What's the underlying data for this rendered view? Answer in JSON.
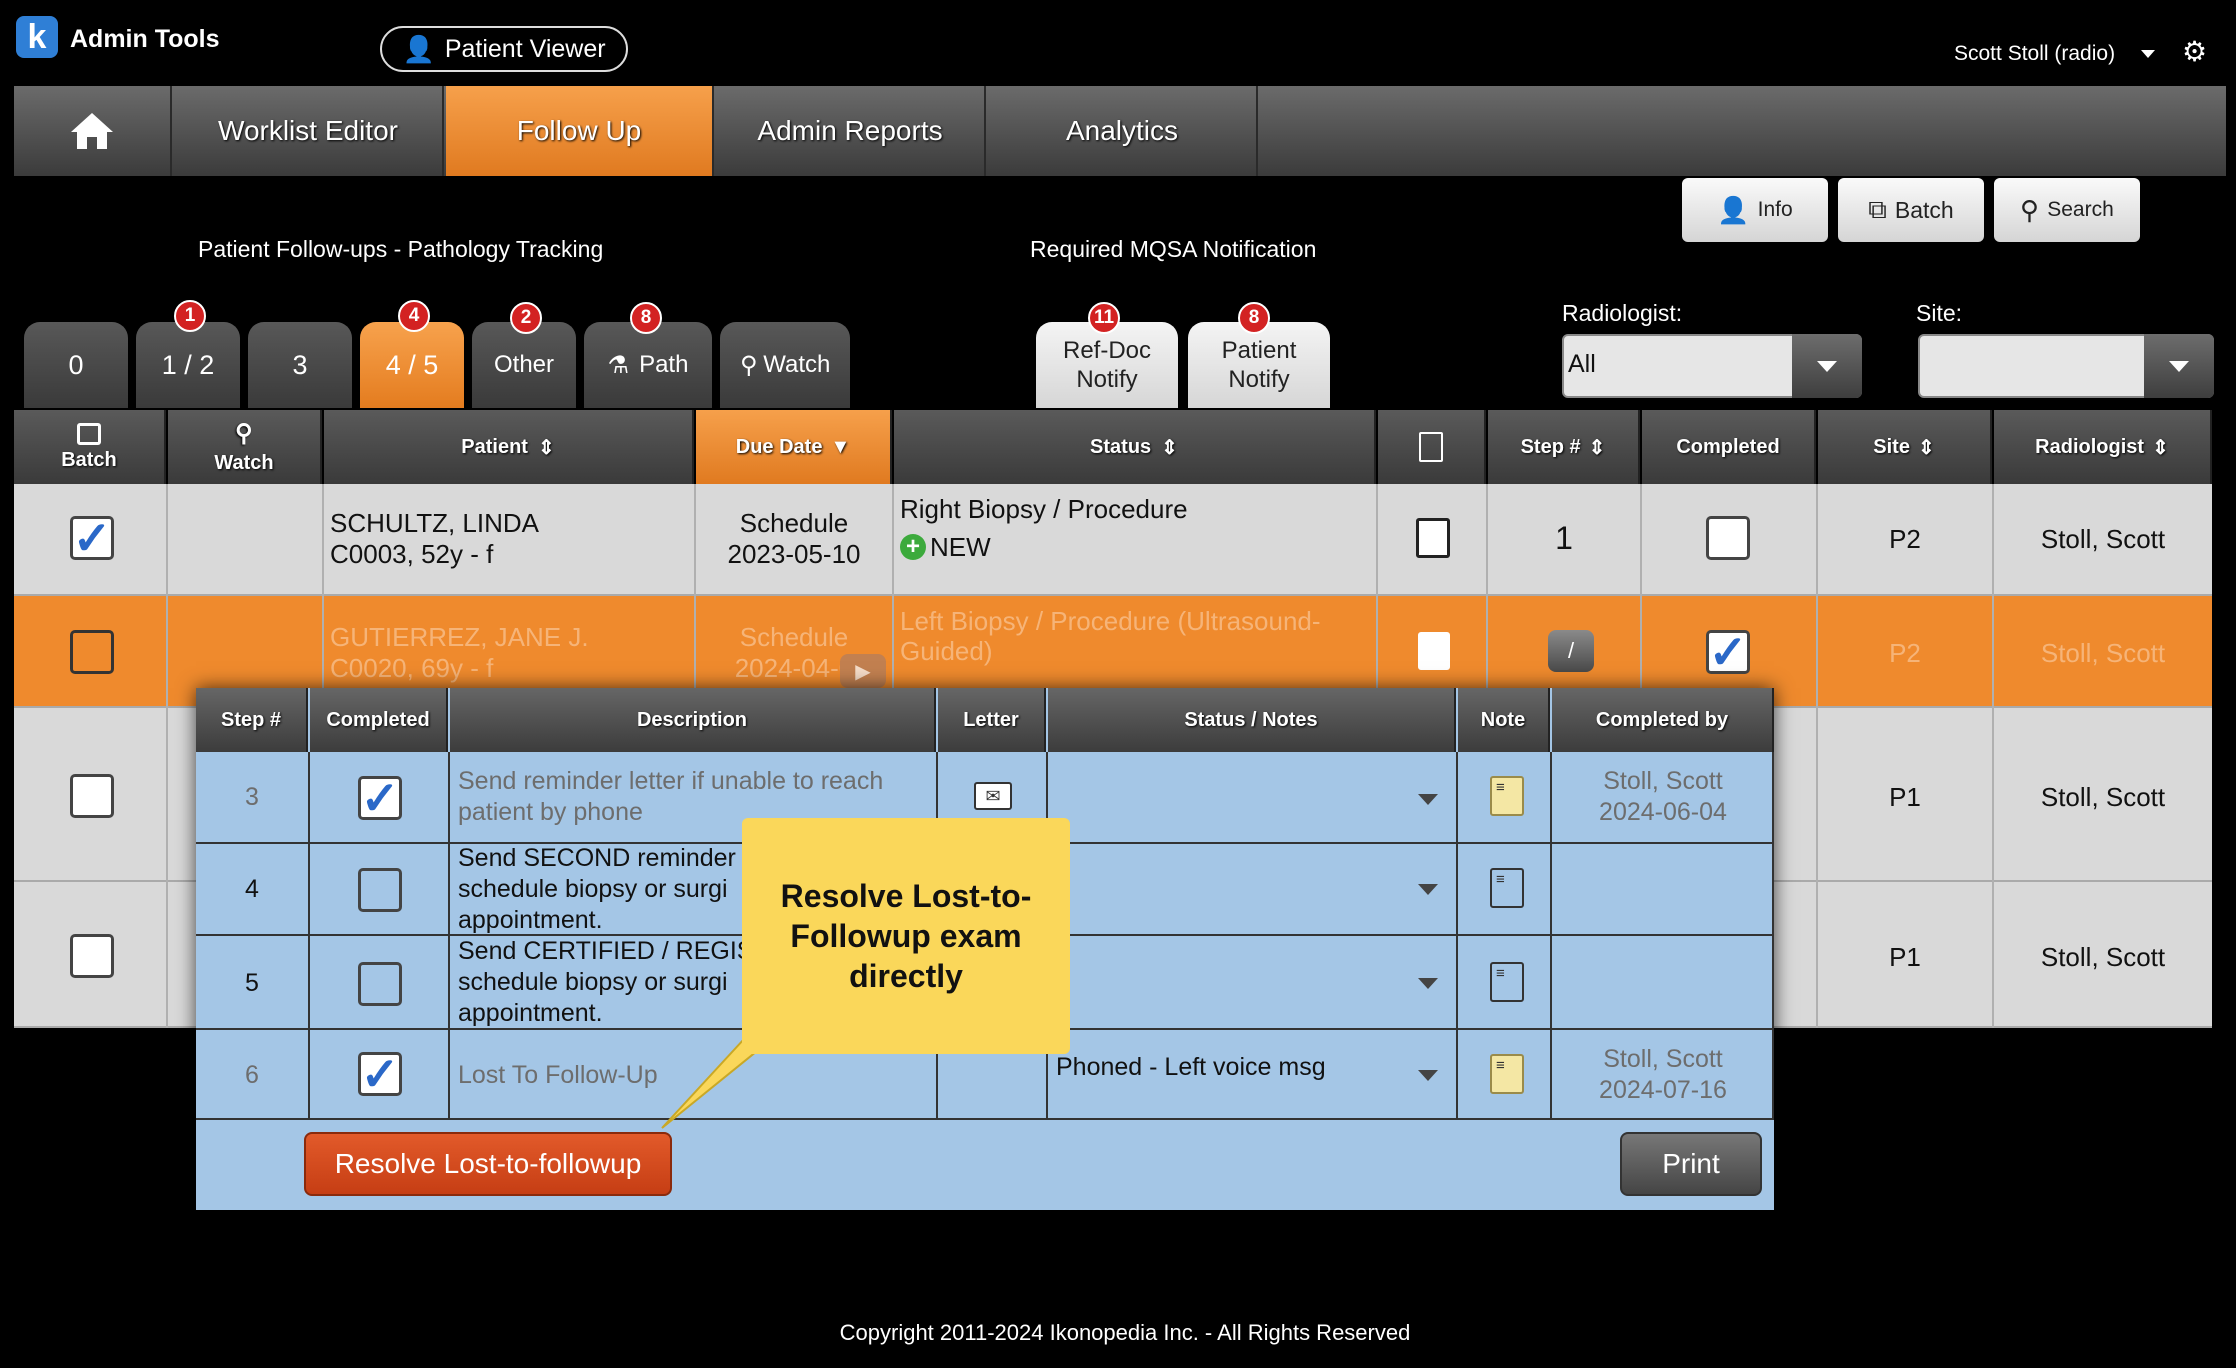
{
  "app": {
    "logo_letter": "k",
    "title": "Admin Tools",
    "patient_viewer": "Patient Viewer",
    "user": "Scott Stoll (radio)"
  },
  "nav": [
    "Worklist Editor",
    "Follow Up",
    "Admin Reports",
    "Analytics"
  ],
  "toolbar": {
    "info": "Info",
    "batch": "Batch",
    "search": "Search"
  },
  "section_labels": {
    "left": "Patient Follow-ups - Pathology Tracking",
    "right": "Required MQSA Notification"
  },
  "tabs": [
    {
      "label": "0",
      "badge": ""
    },
    {
      "label": "1 / 2",
      "badge": "1"
    },
    {
      "label": "3",
      "badge": ""
    },
    {
      "label": "4 / 5",
      "badge": "4"
    },
    {
      "label": "Other",
      "badge": "2"
    },
    {
      "label": "Path",
      "badge": "8"
    },
    {
      "label": "Watch",
      "badge": ""
    }
  ],
  "notify_tabs": [
    {
      "line1": "Ref-Doc",
      "line2": "Notify",
      "badge": "11"
    },
    {
      "line1": "Patient",
      "line2": "Notify",
      "badge": "8"
    }
  ],
  "filters": {
    "radiologist_label": "Radiologist:",
    "radiologist_value": "All",
    "site_label": "Site:",
    "site_value": ""
  },
  "grid": {
    "headers": {
      "batch": "Batch",
      "watch": "Watch",
      "patient": "Patient",
      "due_date": "Due Date",
      "status": "Status",
      "step": "Step #",
      "completed": "Completed",
      "site": "Site",
      "radiologist": "Radiologist"
    },
    "rows": [
      {
        "name": "SCHULTZ, LINDA",
        "info": "C0003, 52y - f",
        "due_label": "Schedule",
        "due_date": "2023-05-10",
        "status": "Right Biopsy / Procedure",
        "status_tag": "NEW",
        "step": "1",
        "site": "P2",
        "radiologist": "Stoll, Scott"
      },
      {
        "name": "GUTIERREZ, JANE J.",
        "info": "C0020, 69y - f",
        "due_label": "Schedule",
        "due_date": "2024-04-0",
        "status": "Left Biopsy / Procedure (Ultrasound-",
        "status2": "Guided)",
        "step": "/",
        "site": "P2",
        "radiologist": "Stoll, Scott"
      },
      {
        "site": "P1",
        "radiologist": "Stoll, Scott"
      },
      {
        "site": "P1",
        "radiologist": "Stoll, Scott"
      }
    ]
  },
  "subtable": {
    "headers": {
      "step": "Step #",
      "completed": "Completed",
      "description": "Description",
      "letter": "Letter",
      "status_notes": "Status / Notes",
      "note": "Note",
      "completed_by": "Completed by"
    },
    "rows": [
      {
        "step": "3",
        "desc1": "Send reminder letter if unable to reach",
        "desc2": "patient by phone",
        "desc3": "",
        "status": "",
        "by1": "Stoll, Scott",
        "by2": "2024-06-04"
      },
      {
        "step": "4",
        "desc1": "Send SECOND reminder",
        "desc2": "schedule biopsy or surgi",
        "desc3": "appointment.",
        "status": "",
        "by1": "",
        "by2": ""
      },
      {
        "step": "5",
        "desc1": "Send CERTIFIED / REGIS",
        "desc2": "schedule biopsy or surgi",
        "desc3": "appointment.",
        "status": "",
        "by1": "",
        "by2": ""
      },
      {
        "step": "6",
        "desc1": "Lost To Follow-Up",
        "desc2": "",
        "desc3": "",
        "status": "Phoned - Left voice msg",
        "by1": "Stoll, Scott",
        "by2": "2024-07-16"
      }
    ],
    "resolve_button": "Resolve Lost-to-followup",
    "print_button": "Print"
  },
  "callout": {
    "line1": "Resolve Lost-to-",
    "line2": "Followup exam",
    "line3": "directly"
  },
  "footer": "Copyright 2011-2024 Ikonopedia Inc. - All Rights Reserved",
  "colors": {
    "accent": "#ef8a2d",
    "panel": "#a4c6e6",
    "badge": "#d32222",
    "resolve": "#d44a1e",
    "callout": "#fad75a"
  }
}
